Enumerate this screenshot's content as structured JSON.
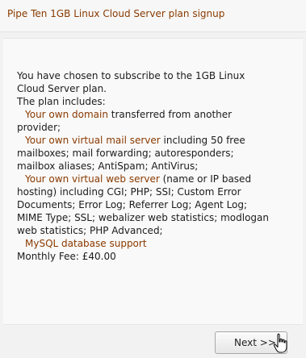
{
  "window": {
    "title": "Pipe Ten 1GB Linux Cloud Server plan signup"
  },
  "content": {
    "intro_1": "You have chosen to subscribe to the 1GB Linux",
    "intro_2": "Cloud Server plan.",
    "includes": "The plan includes:",
    "domain_feat": "Your own domain",
    "domain_rest": " transferred from another",
    "domain_rest_2": "provider;",
    "mail_feat": "Your own virtual mail server",
    "mail_rest": " including 50 free",
    "mail_rest_2": "mailboxes; mail forwarding; autoresponders;",
    "mail_rest_3": "mailbox aliases; AntiSpam; AntiVirus;",
    "web_feat": "Your own virtual web server",
    "web_rest": " (name or IP based",
    "web_rest_2": "hosting) including CGI; PHP; SSI; Custom Error",
    "web_rest_3": "Documents; Error Log; Referrer Log; Agent Log;",
    "web_rest_4": "MIME Type; SSL; webalizer web statistics; modlogan",
    "web_rest_5": "web statistics; PHP Advanced;",
    "mysql_feat": "MySQL database support",
    "monthly_fee": "Monthly Fee: £40.00"
  },
  "footer": {
    "next_label": "Next >>"
  },
  "colors": {
    "feature_highlight": "#8a3a00",
    "title_text": "#8a3a00",
    "body_text": "#1c1c1c"
  },
  "icons": {
    "cursor": "hand-pointer-icon"
  }
}
